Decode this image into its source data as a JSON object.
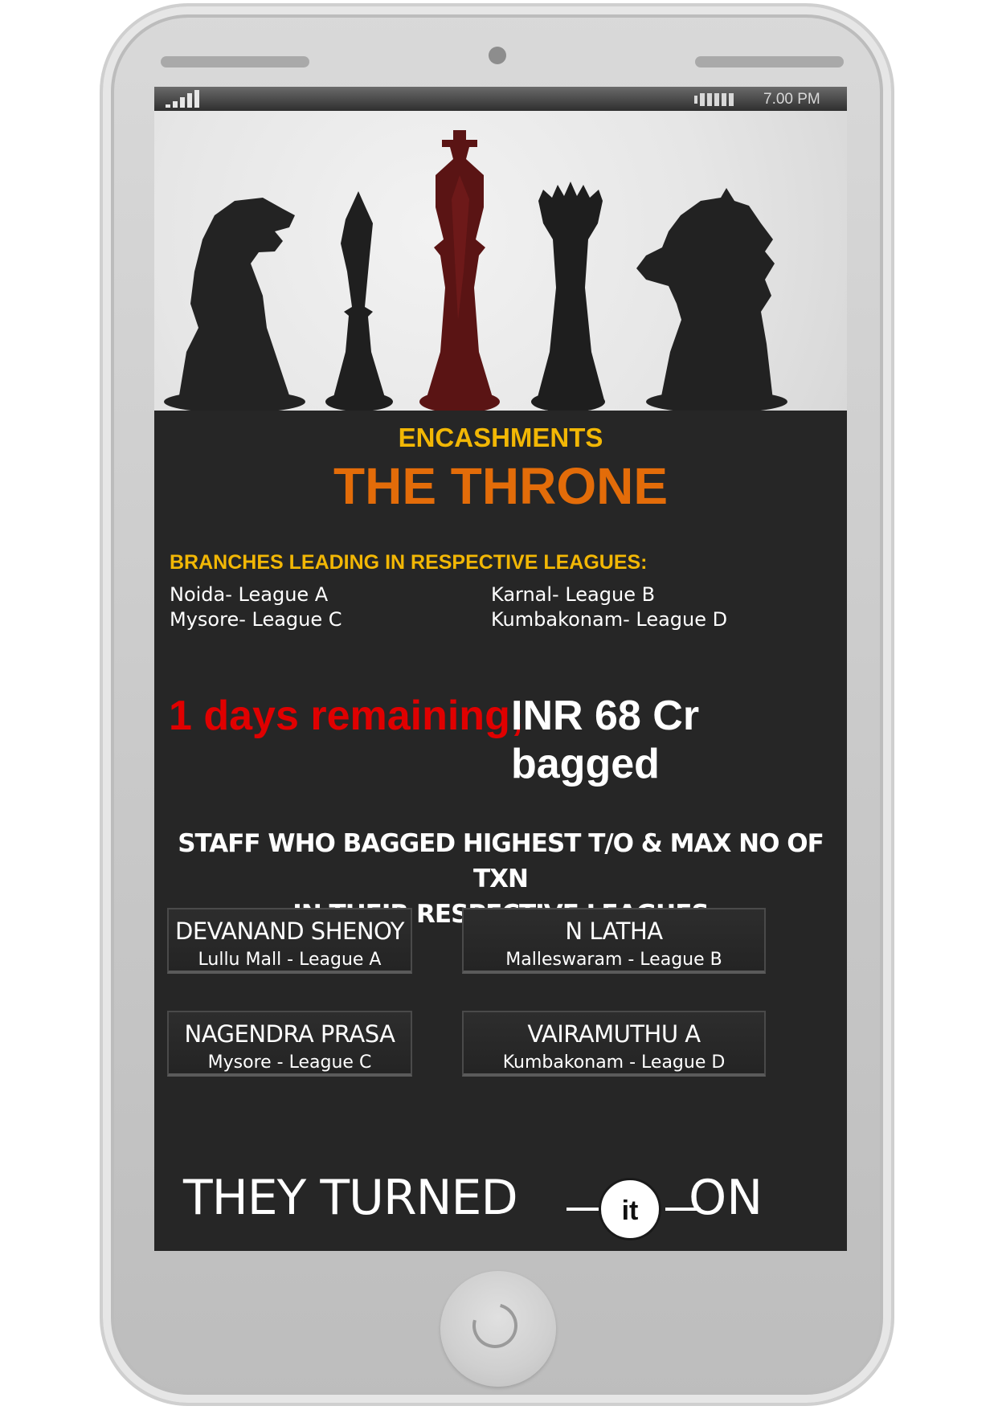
{
  "statusbar": {
    "time": "7.00 PM"
  },
  "header": {
    "subtitle": "ENCASHMENTS",
    "title": "THE THRONE"
  },
  "branches": {
    "heading": "BRANCHES LEADING IN RESPECTIVE LEAGUES:",
    "items": [
      "Noida- League A",
      "Karnal- League B",
      "Mysore- League C",
      "Kumbakonam- League D"
    ]
  },
  "stats": {
    "remaining": "1 days remaining;",
    "bagged": "INR 68 Cr bagged"
  },
  "staff": {
    "heading_line1": "STAFF WHO BAGGED HIGHEST T/O & MAX NO OF TXN",
    "heading_line2": "IN THEIR RESPECTIVE LEAGUES",
    "cards": [
      {
        "name": "DEVANAND SHENOY",
        "branch": "Lullu Mall - League A"
      },
      {
        "name": "N LATHA",
        "branch": "Malleswaram - League B"
      },
      {
        "name": "NAGENDRA PRASA",
        "branch": "Mysore - League C"
      },
      {
        "name": "VAIRAMUTHU A",
        "branch": "Kumbakonam - League D"
      }
    ]
  },
  "tagline": {
    "left": "THEY TURNED",
    "badge": "it",
    "right": "ON"
  },
  "colors": {
    "subtitle": "#f2b705",
    "title": "#e36c09",
    "remaining": "#e00000",
    "screen_bg": "#262626"
  },
  "icons": [
    "signal-icon",
    "battery-icon",
    "home-button-icon",
    "chess-pieces-illustration"
  ]
}
